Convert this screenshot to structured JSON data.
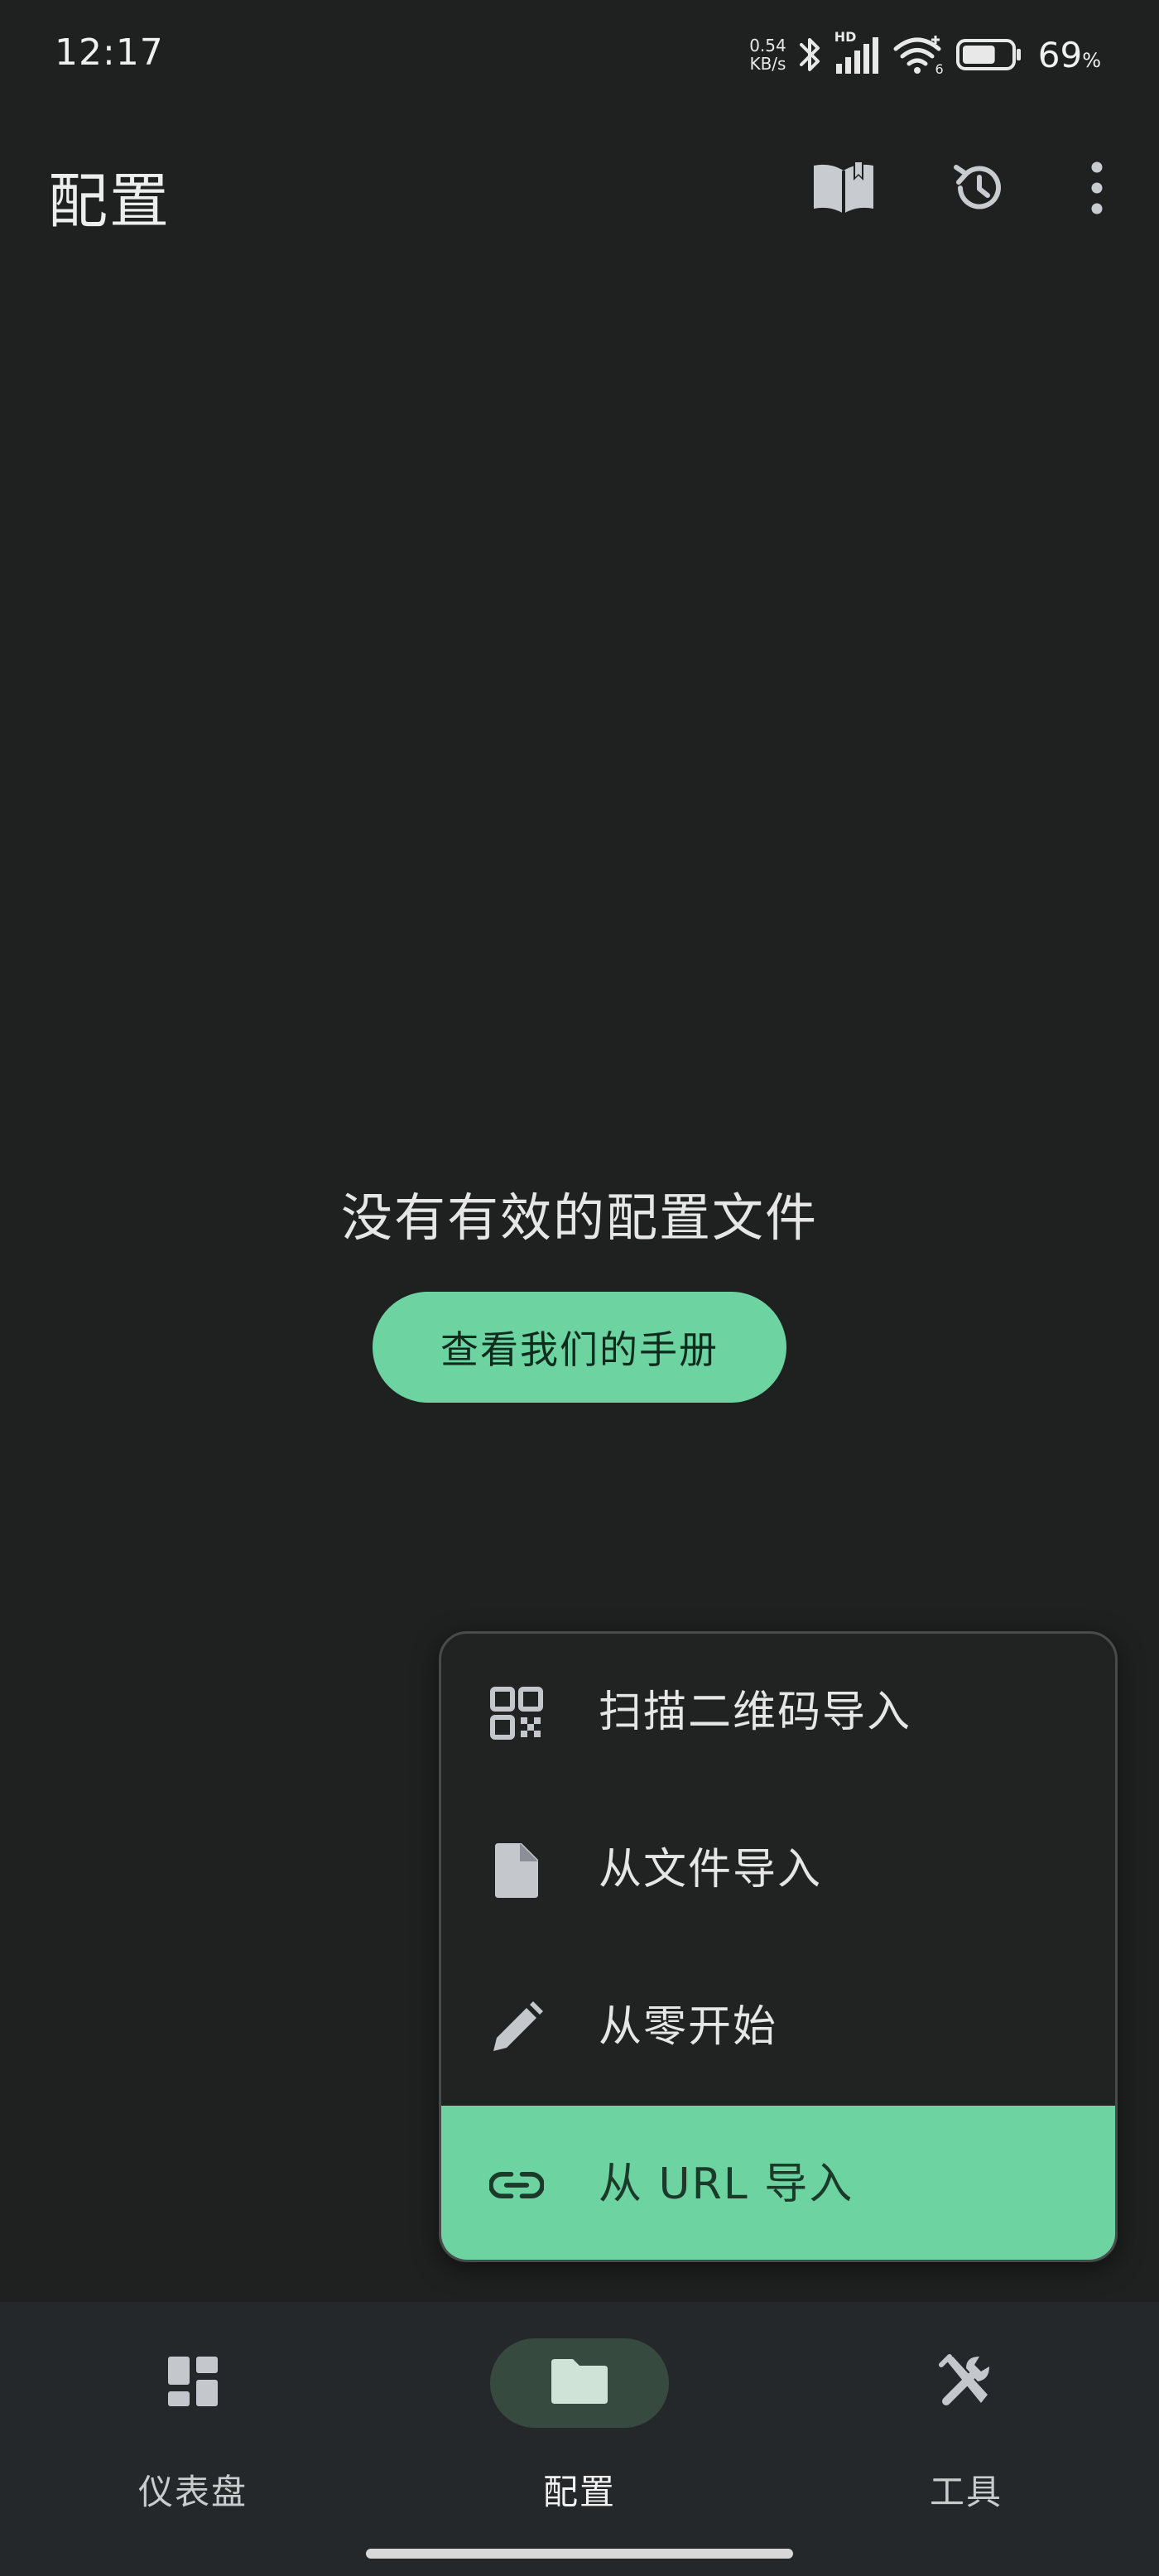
{
  "status_bar": {
    "time": "12:17",
    "net_speed_value": "0.54",
    "net_speed_unit": "KB/s",
    "signal_badge": "HD",
    "wifi_badge": "6",
    "battery_percent": "69",
    "battery_unit": "%",
    "battery_level": 0.69
  },
  "app_bar": {
    "title": "配置",
    "actions": [
      {
        "icon": "book-open-icon"
      },
      {
        "icon": "history-icon"
      },
      {
        "icon": "more-vert-icon"
      }
    ]
  },
  "empty_state": {
    "message": "没有有效的配置文件",
    "button_label": "查看我们的手册"
  },
  "import_menu": {
    "items": [
      {
        "label": "扫描二维码导入",
        "icon": "qr-code-icon"
      },
      {
        "label": "从文件导入",
        "icon": "file-icon"
      },
      {
        "label": "从零开始",
        "icon": "pencil-icon"
      },
      {
        "label": "从 URL 导入",
        "icon": "link-icon"
      }
    ]
  },
  "bottom_nav": {
    "items": [
      {
        "label": "仪表盘",
        "icon": "dashboard-icon"
      },
      {
        "label": "配置",
        "icon": "folder-icon"
      },
      {
        "label": "工具",
        "icon": "tools-icon"
      }
    ]
  },
  "colors": {
    "background": "#1f2020",
    "accent": "#6dd3a1",
    "nav_background": "#25282b",
    "nav_active_pill": "#374a40"
  }
}
